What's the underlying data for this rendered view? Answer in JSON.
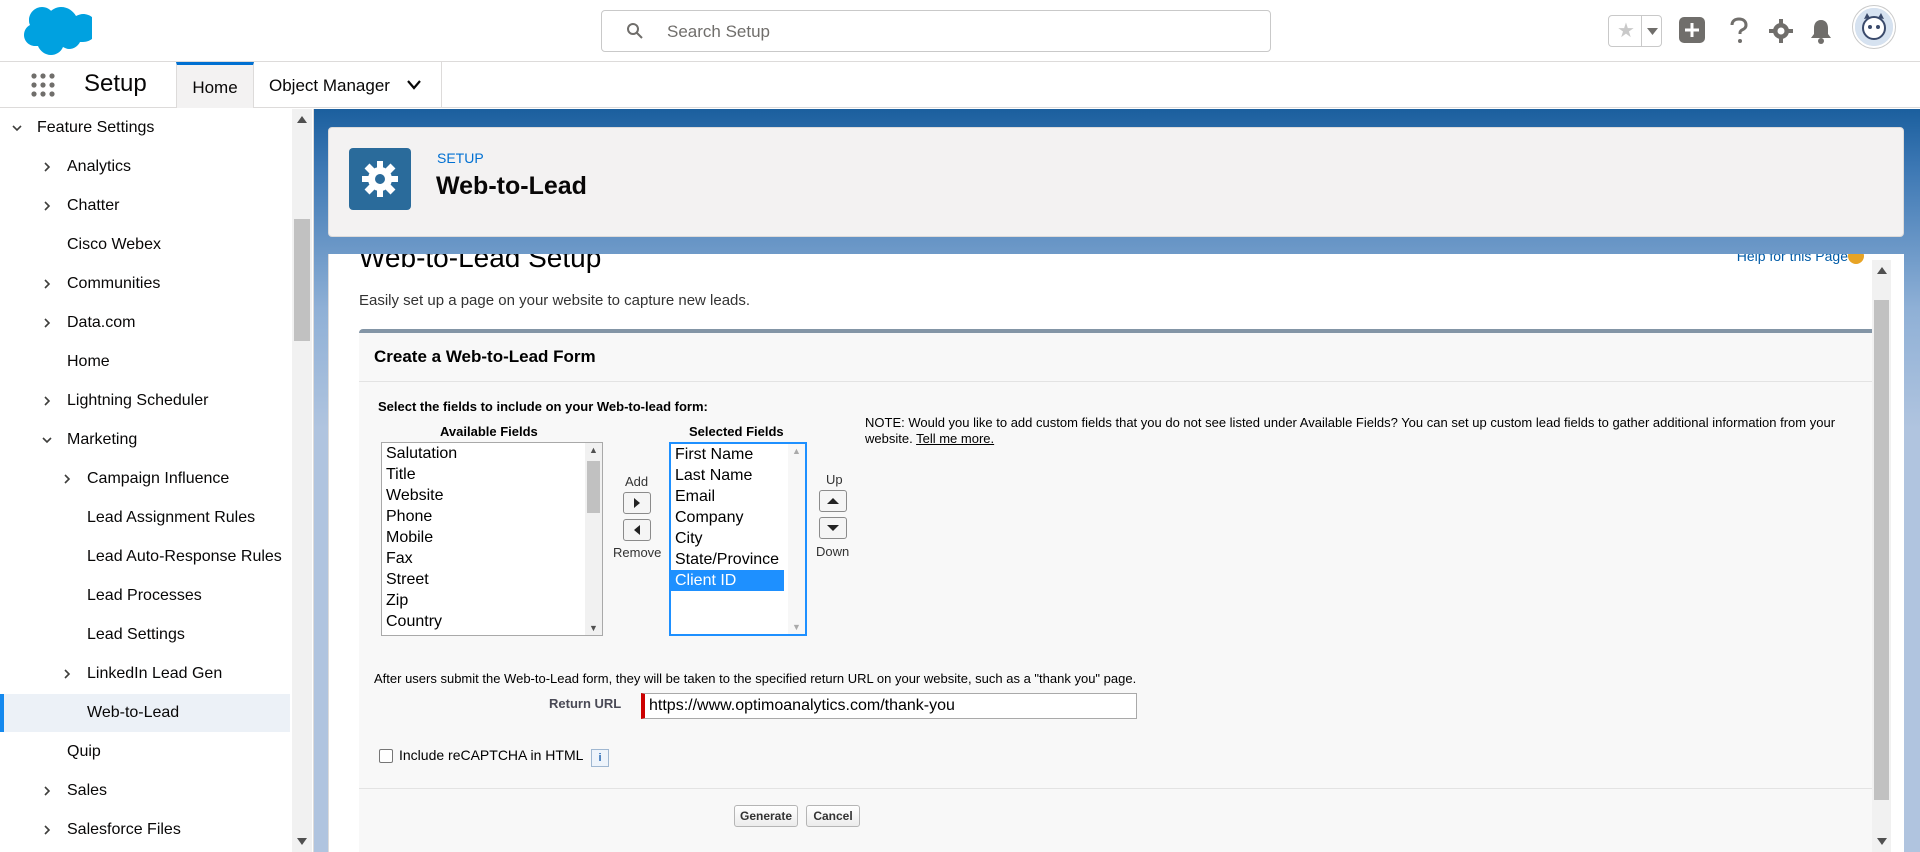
{
  "header": {
    "search_placeholder": "Search Setup"
  },
  "nav": {
    "app_title": "Setup",
    "tabs": [
      {
        "label": "Home"
      },
      {
        "label": "Object Manager"
      }
    ]
  },
  "tree": {
    "items": [
      {
        "label": "Feature Settings"
      },
      {
        "label": "Analytics"
      },
      {
        "label": "Chatter"
      },
      {
        "label": "Cisco Webex"
      },
      {
        "label": "Communities"
      },
      {
        "label": "Data.com"
      },
      {
        "label": "Home"
      },
      {
        "label": "Lightning Scheduler"
      },
      {
        "label": "Marketing"
      },
      {
        "label": "Campaign Influence"
      },
      {
        "label": "Lead Assignment Rules"
      },
      {
        "label": "Lead Auto-Response Rules"
      },
      {
        "label": "Lead Processes"
      },
      {
        "label": "Lead Settings"
      },
      {
        "label": "LinkedIn Lead Gen"
      },
      {
        "label": "Web-to-Lead"
      },
      {
        "label": "Quip"
      },
      {
        "label": "Sales"
      },
      {
        "label": "Salesforce Files"
      }
    ]
  },
  "page_header": {
    "eyebrow": "SETUP",
    "title": "Web-to-Lead"
  },
  "content": {
    "title": "Web-to-Lead Setup",
    "help_link": "Help for this Page",
    "description": "Easily set up a page on your website to capture new leads."
  },
  "form": {
    "title": "Create a Web-to-Lead Form",
    "instruction": "Select the fields to include on your Web-to-lead form:",
    "available_header": "Available Fields",
    "selected_header": "Selected Fields",
    "available_fields": [
      "Salutation",
      "Title",
      "Website",
      "Phone",
      "Mobile",
      "Fax",
      "Street",
      "Zip",
      "Country"
    ],
    "selected_fields": [
      "First Name",
      "Last Name",
      "Email",
      "Company",
      "City",
      "State/Province",
      "Client ID"
    ],
    "add_label": "Add",
    "remove_label": "Remove",
    "up_label": "Up",
    "down_label": "Down",
    "note_text": "NOTE: Would you like to add custom fields that you do not see listed under Available Fields? You can set up custom lead fields to gather additional information from your website.",
    "note_link": "Tell me more.",
    "after_text": "After users submit the Web-to-Lead form, they will be taken to the specified return URL on your website, such as a \"thank you\" page.",
    "return_url_label": "Return URL",
    "return_url_value": "https://www.optimoanalytics.com/thank-you",
    "recaptcha_label": "Include reCAPTCHA in HTML",
    "info_glyph": "i",
    "generate_label": "Generate",
    "cancel_label": "Cancel"
  },
  "colors": {
    "brand_blue": "#0070d2",
    "header_icon_bg": "#2a6b9b",
    "selection_blue": "#1e90ff",
    "required_bar": "#cc0000"
  }
}
